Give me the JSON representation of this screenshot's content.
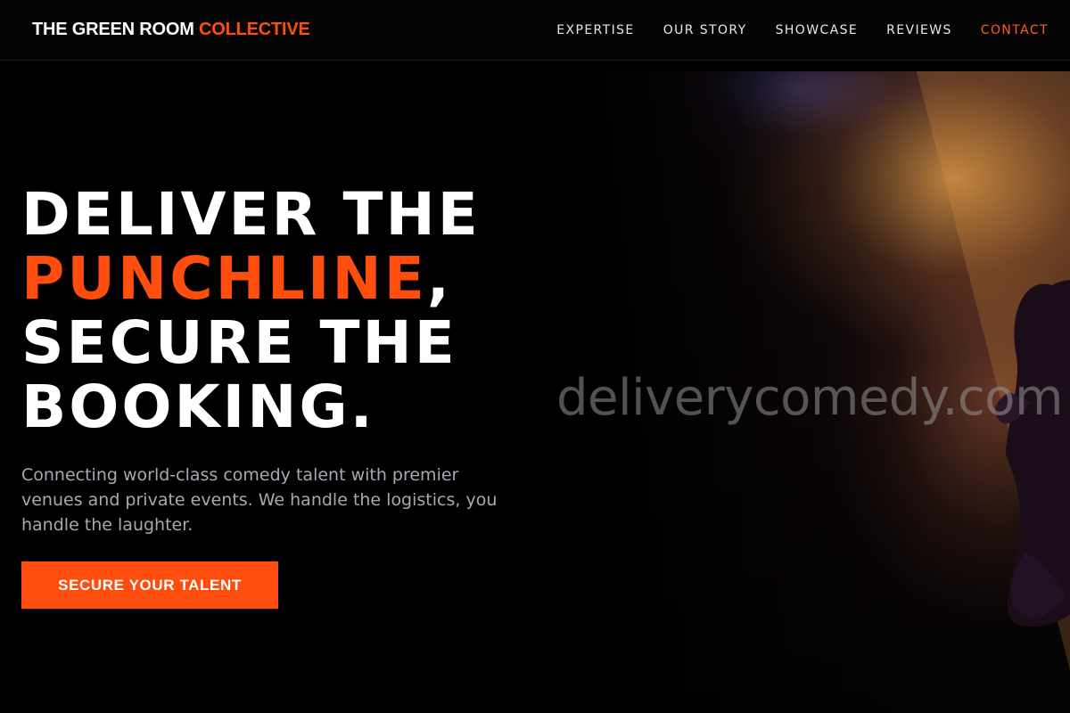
{
  "header": {
    "logo_main": "THE GREEN ROOM",
    "logo_accent": "COLLECTIVE",
    "nav": [
      "EXPERTISE",
      "OUR STORY",
      "SHOWCASE",
      "REVIEWS",
      "CONTACT"
    ]
  },
  "hero": {
    "headline_line1": "DELIVER THE",
    "headline_highlight": "PUNCHLINE",
    "headline_comma": ",",
    "headline_line3": "SECURE THE",
    "headline_line4": "BOOKING.",
    "subcopy": "Connecting world-class comedy talent with premier venues and private events. We handle the logistics, you handle the laughter.",
    "cta_label": "SECURE YOUR TALENT",
    "watermark": "deliverycomedy.com"
  },
  "colors": {
    "accent": "#ff4d0d",
    "background": "#000000",
    "subcopy": "#a8a8b2"
  },
  "icons": [
    "stage-performer-photo"
  ]
}
